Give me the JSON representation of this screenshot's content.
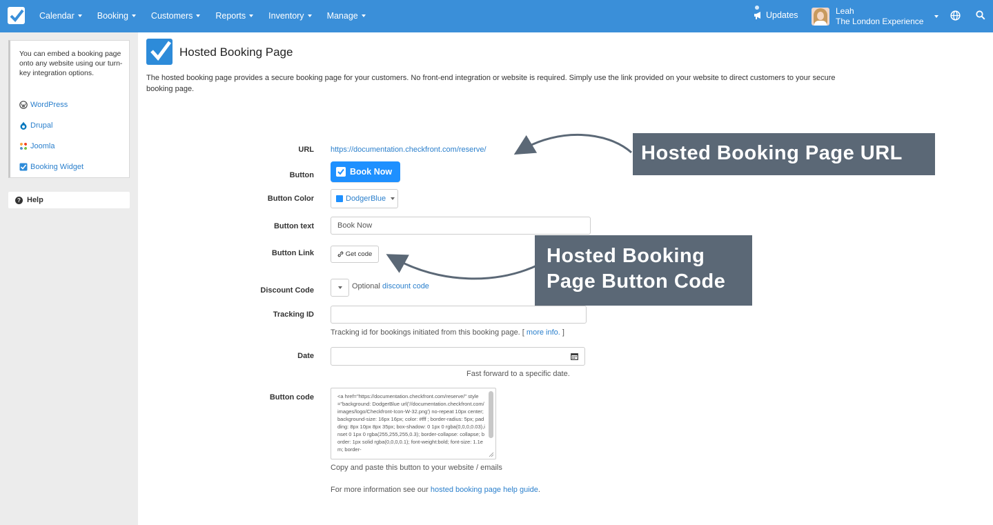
{
  "topbar": {
    "nav": [
      {
        "label": "Calendar"
      },
      {
        "label": "Booking"
      },
      {
        "label": "Customers"
      },
      {
        "label": "Reports"
      },
      {
        "label": "Inventory"
      },
      {
        "label": "Manage"
      }
    ],
    "updates_label": "Updates",
    "user_name": "Leah",
    "user_org": "The London Experience"
  },
  "sidebar": {
    "intro": "You can embed a booking page onto any website using our turn-key integration options.",
    "links": [
      {
        "label": "WordPress",
        "icon": "wordpress-icon"
      },
      {
        "label": "Drupal",
        "icon": "drupal-icon"
      },
      {
        "label": "Joomla",
        "icon": "joomla-icon"
      },
      {
        "label": "Booking Widget",
        "icon": "checkbox-icon"
      }
    ],
    "help_label": "Help"
  },
  "page": {
    "title": "Hosted Booking Page",
    "description": "The hosted booking page provides a secure booking page for your customers. No front-end integration or website is required. Simply use the link provided on your website to direct customers to your secure booking page."
  },
  "form": {
    "url_label": "URL",
    "url_value": "https://documentation.checkfront.com/reserve/",
    "button_label": "Button",
    "button_preview": "Book Now",
    "color_label": "Button Color",
    "color_value": "DodgerBlue",
    "color_hex": "#1e90ff",
    "text_label": "Button text",
    "text_value": "Book Now",
    "link_label": "Button Link",
    "get_code": "Get code",
    "discount_label": "Discount Code",
    "discount_optional": "Optional",
    "discount_link": "discount code",
    "tracking_label": "Tracking ID",
    "tracking_value": "",
    "tracking_help_pre": "Tracking id for bookings initiated from this booking page. [",
    "tracking_help_link": "more info.",
    "tracking_help_post": "]",
    "date_label": "Date",
    "date_value": "",
    "date_help": "Fast forward to a specific date.",
    "code_label": "Button code",
    "code_value": "<a href=\"https://documentation.checkfront.com/reserve/\" style=\"background: DodgerBlue url('//documentation.checkfront.com/images/logo/Checkfront-Icon-W-32.png') no-repeat 10px center; background-size: 16px 16px; color: #fff ; border-radius: 5px; padding: 8px 10px 8px 35px; box-shadow: 0 1px 0 rgba(0,0,0,0.03),inset 0 1px 0 rgba(255,255,255,0.3); border-collapse: collapse; border: 1px solid rgba(0,0,0,0.1); font-weight:bold; font-size: 1.1em; border-",
    "code_help": "Copy and paste this button to your website / emails",
    "more_pre": "For more information see our",
    "more_link": "hosted booking page help guide",
    "more_post": "."
  },
  "callouts": {
    "url": "Hosted Booking Page URL",
    "code": "Hosted Booking Page Button Code"
  },
  "colors": {
    "nav_bg": "#3a8fd9",
    "link": "#2a7fcc",
    "callout_bg": "#5b6876",
    "button_bg": "#1e90ff"
  }
}
